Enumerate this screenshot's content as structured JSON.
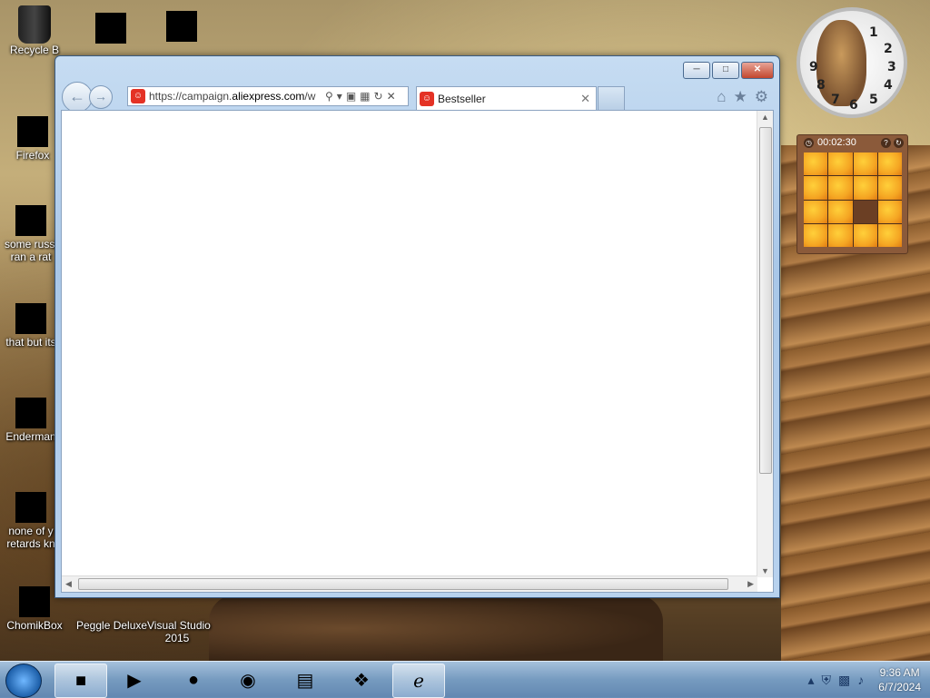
{
  "desktop": {
    "icons": [
      {
        "label": "Recycle B"
      },
      {
        "label": "Firefox"
      },
      {
        "label": "some russi",
        "label2": "ran a rat"
      },
      {
        "label": "that but its"
      },
      {
        "label": "Enderman"
      },
      {
        "label": "none of y",
        "label2": "retards kn"
      },
      {
        "label": "ChomikBox"
      },
      {
        "label": "Peggle Deluxe"
      },
      {
        "label": "Visual Studio",
        "label2": "2015"
      }
    ]
  },
  "browser": {
    "address": {
      "url_prefix": "https://campaign.",
      "url_domain": "aliexpress.com",
      "url_suffix": "/w"
    },
    "tab": {
      "title": "Bestseller"
    }
  },
  "gadgets": {
    "clock_numbers": [
      "1",
      "2",
      "3",
      "4",
      "5",
      "6",
      "7",
      "8",
      "9"
    ],
    "puzzle": {
      "timer": "00:02:30"
    }
  },
  "taskbar": {
    "time": "9:36 AM",
    "date": "6/7/2024"
  },
  "colors": {
    "accent": "#3a5a80",
    "close_button": "#c2462e",
    "taskbar": "#789fc8"
  }
}
